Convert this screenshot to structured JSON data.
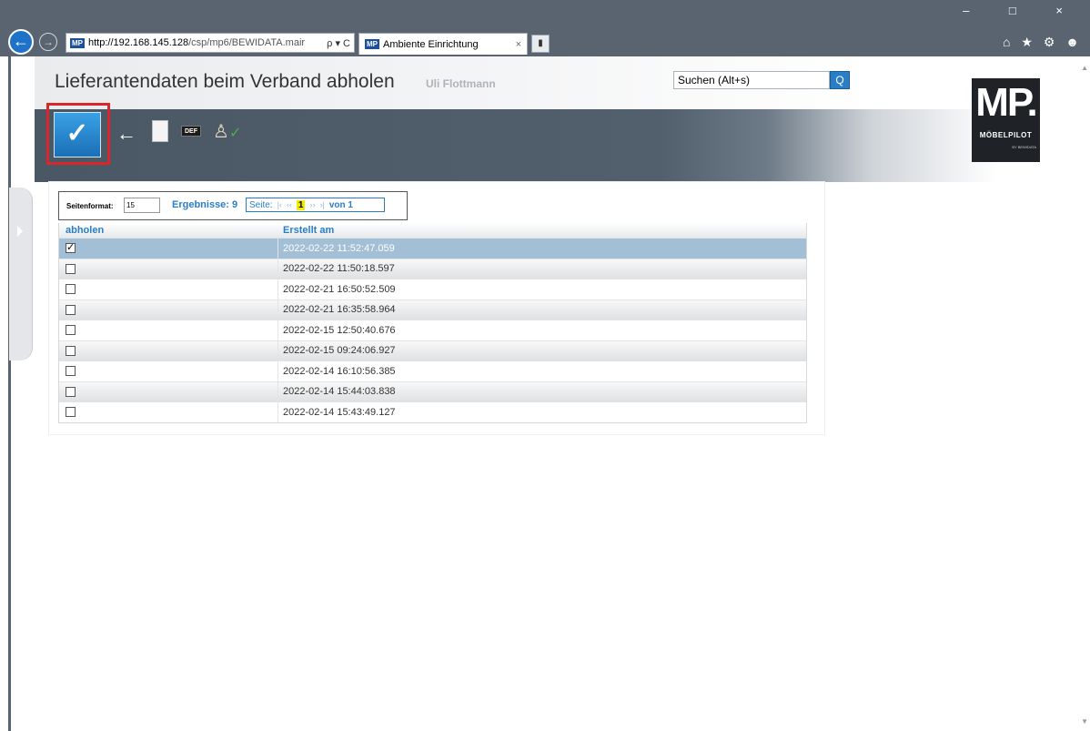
{
  "browser": {
    "url_host": "http://192.168.145.128",
    "url_path": "/csp/mp6/BEWIDATA.mair",
    "address_tools": "ρ ▾ C",
    "tab_title": "Ambiente Einrichtung",
    "tab_close": "×",
    "favicon_text": "MP",
    "window_controls": "–  □  ×",
    "right_icons": "⌂ ★ ⚙ ☻"
  },
  "header": {
    "title": "Lieferantendaten beim Verband abholen",
    "user": "Uli Flottmann",
    "search_value": "Suchen (Alt+s)",
    "search_button": "Q"
  },
  "toolbar": {
    "confirm_label": "✓",
    "back_icon": "←",
    "def_label": "DEF",
    "user_icon": "♙",
    "user_tick": "✓"
  },
  "logo": {
    "mark": "MP.",
    "name": "MÖBELPILOT",
    "sub": "BY BEWIDATA"
  },
  "pager": {
    "format_label": "Seitenformat:",
    "format_value": "15",
    "results": "Ergebnisse: 9",
    "page_label": "Seite:",
    "first": "|‹",
    "prev": "‹‹",
    "current": "1",
    "next": "››",
    "last": "›|",
    "of": "von 1"
  },
  "table": {
    "columns": [
      "abholen",
      "Erstellt am"
    ],
    "rows": [
      {
        "checked": true,
        "created": "2022-02-22 11:52:47.059"
      },
      {
        "checked": false,
        "created": "2022-02-22 11:50:18.597"
      },
      {
        "checked": false,
        "created": "2022-02-21 16:50:52.509"
      },
      {
        "checked": false,
        "created": "2022-02-21 16:35:58.964"
      },
      {
        "checked": false,
        "created": "2022-02-15 12:50:40.676"
      },
      {
        "checked": false,
        "created": "2022-02-15 09:24:06.927"
      },
      {
        "checked": false,
        "created": "2022-02-14 16:10:56.385"
      },
      {
        "checked": false,
        "created": "2022-02-14 15:44:03.838"
      },
      {
        "checked": false,
        "created": "2022-02-14 15:43:49.127"
      }
    ]
  }
}
